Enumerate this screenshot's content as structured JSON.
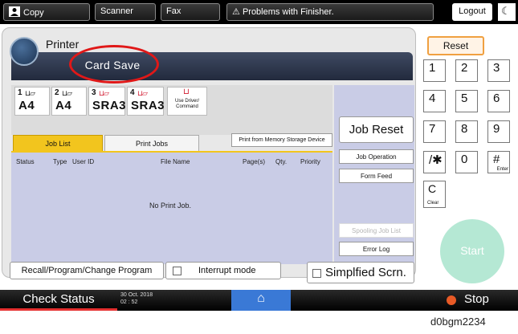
{
  "topbar": {
    "copy": "Copy",
    "scanner": "Scanner",
    "fax": "Fax",
    "problem": "Problems with Finisher.",
    "logout": "Logout",
    "moon": "☾"
  },
  "app": {
    "title": "Printer",
    "highlight": "Card Save",
    "highlight_color": "#e01818"
  },
  "trays": [
    {
      "num": "1",
      "size": "A4"
    },
    {
      "num": "2",
      "size": "A4"
    },
    {
      "num": "3",
      "size": "SRA3"
    },
    {
      "num": "4",
      "size": "SRA3"
    }
  ],
  "use_driver": "Use Driver/ Command",
  "tabs": {
    "job_list": "Job List",
    "print_jobs": "Print Jobs",
    "memory_print": "Print from Memory Storage Device"
  },
  "columns": [
    "Status",
    "Type",
    "User ID",
    "File Name",
    "Page(s)",
    "Qty.",
    "Priority"
  ],
  "no_job": "No Print Job.",
  "right_buttons": {
    "job_reset": "Job Reset",
    "job_operation": "Job Operation",
    "form_feed": "Form Feed",
    "spooling": "Spooling Job List",
    "error_log": "Error Log"
  },
  "bottom_buttons": {
    "recall": "Recall/Program/Change Program",
    "interrupt": "Interrupt mode",
    "simplified": "Simplfied Scrn."
  },
  "keypad": {
    "reset": "Reset",
    "keys": [
      "1",
      "2",
      "3",
      "4",
      "5",
      "6",
      "7",
      "8",
      "9",
      "/✱",
      "0",
      "#"
    ],
    "enter": "Enter",
    "clear_key": "C",
    "clear_sub": "Clear",
    "start": "Start"
  },
  "status": {
    "check_status": "Check Status",
    "date": "30 Oct. 2018",
    "time": "02 : 52",
    "home_icon": "⌂",
    "stop": "Stop"
  },
  "caption": "d0bgm2234"
}
